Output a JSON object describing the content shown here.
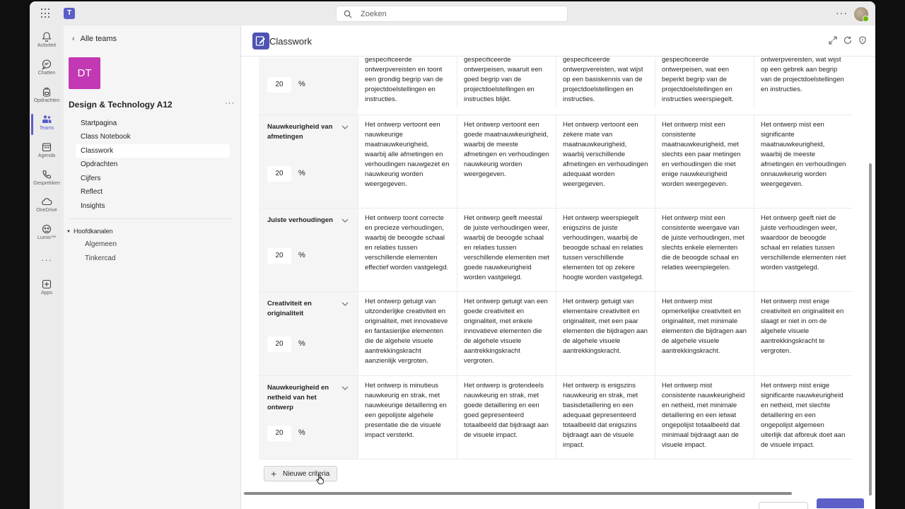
{
  "search": {
    "placeholder": "Zoeken"
  },
  "rail": [
    {
      "label": "Activiteit",
      "icon": "bell-icon"
    },
    {
      "label": "Chatten",
      "icon": "chat-icon"
    },
    {
      "label": "Opdrachten",
      "icon": "backpack-icon"
    },
    {
      "label": "Teams",
      "icon": "teams-icon",
      "active": true
    },
    {
      "label": "Agenda",
      "icon": "calendar-icon"
    },
    {
      "label": "Gesprekken",
      "icon": "phone-icon"
    },
    {
      "label": "OneDrive",
      "icon": "cloud-icon"
    },
    {
      "label": "Lumio™",
      "icon": "lumio-icon"
    },
    {
      "label": "Apps",
      "icon": "apps-icon"
    }
  ],
  "team": {
    "back_label": "Alle teams",
    "initials": "DT",
    "name": "Design & Technology A12",
    "nav": [
      "Startpagina",
      "Class Notebook",
      "Classwork",
      "Opdrachten",
      "Cijfers",
      "Reflect",
      "Insights"
    ],
    "channels_header": "Hoofdkanalen",
    "channels": [
      "Algemeen",
      "Tinkercad"
    ]
  },
  "app": {
    "title": "Classwork"
  },
  "rubric": {
    "rows": [
      {
        "name": "",
        "weight": "20",
        "cells": [
          "gespecificeerde ontwerpvereisten en toont een grondig begrip van de projectdoelstellingen en instructies.",
          "gespecificeerde ontwerpeisen, waaruit een goed begrip van de projectdoelstellingen en instructies blijkt.",
          "gespecificeerde ontwerpvereisten, wat wijst op een basiskennis van de projectdoelstellingen en instructies.",
          "gespecificeerde ontwerpeisen, wat een beperkt begrip van de projectdoelstellingen en instructies weerspiegelt.",
          "ontwerpvereisten, wat wijst op een gebrek aan begrip van de projectdoelstellingen en instructies."
        ]
      },
      {
        "name": "Nauwkeurigheid van afmetingen",
        "weight": "20",
        "cells": [
          "Het ontwerp vertoont een nauwkeurige maatnauwkeurigheid, waarbij alle afmetingen en verhoudingen nauwgezet en nauwkeurig worden weergegeven.",
          "Het ontwerp vertoont een goede maatnauwkeurigheid, waarbij de meeste afmetingen en verhoudingen nauwkeurig worden weergegeven.",
          "Het ontwerp vertoont een zekere mate van maatnauwkeurigheid, waarbij verschillende afmetingen en verhoudingen adequaat worden weergegeven.",
          "Het ontwerp mist een consistente maatnauwkeurigheid, met slechts een paar metingen en verhoudingen die met enige nauwkeurigheid worden weergegeven.",
          "Het ontwerp mist een significante maatnauwkeurigheid, waarbij de meeste afmetingen en verhoudingen onnauwkeurig worden weergegeven."
        ]
      },
      {
        "name": "Juiste verhoudingen",
        "weight": "20",
        "cells": [
          "Het ontwerp toont correcte en precieze verhoudingen, waarbij de beoogde schaal en relaties tussen verschillende elementen effectief worden vastgelegd.",
          "Het ontwerp geeft meestal de juiste verhoudingen weer, waarbij de beoogde schaal en relaties tussen verschillende elementen met goede nauwkeurigheid worden vastgelegd.",
          "Het ontwerp weerspiegelt enigszins de juiste verhoudingen, waarbij de beoogde schaal en relaties tussen verschillende elementen tot op zekere hoogte worden vastgelegd.",
          "Het ontwerp mist een consistente weergave van de juiste verhoudingen, met slechts enkele elementen die de beoogde schaal en relaties weerspiegelen.",
          "Het ontwerp geeft niet de juiste verhoudingen weer, waardoor de beoogde schaal en relaties tussen verschillende elementen niet worden vastgelegd."
        ]
      },
      {
        "name": "Creativiteit en originaliteit",
        "weight": "20",
        "cells": [
          "Het ontwerp getuigt van uitzonderlijke creativiteit en originaliteit, met innovatieve en fantasierijke elementen die de algehele visuele aantrekkingskracht aanzienlijk vergroten.",
          "Het ontwerp getuigt van een goede creativiteit en originaliteit, met enkele innovatieve elementen die de algehele visuele aantrekkingskracht vergroten.",
          "Het ontwerp getuigt van elementaire creativiteit en originaliteit, met een paar elementen die bijdragen aan de algehele visuele aantrekkingskracht.",
          "Het ontwerp mist opmerkelijke creativiteit en originaliteit, met minimale elementen die bijdragen aan de algehele visuele aantrekkingskracht.",
          "Het ontwerp mist enige creativiteit en originaliteit en slaagt er niet in om de algehele visuele aantrekkingskracht te vergroten."
        ]
      },
      {
        "name": "Nauwkeurigheid en netheid van het ontwerp",
        "weight": "20",
        "cells": [
          "Het ontwerp is minutieus nauwkeurig en strak, met nauwkeurige detaillering en een gepolijste algehele presentatie die de visuele impact versterkt.",
          "Het ontwerp is grotendeels nauwkeurig en strak, met goede detaillering en een goed gepresenteerd totaalbeeld dat bijdraagt aan de visuele impact.",
          "Het ontwerp is enigszins nauwkeurig en strak, met basisdetaillering en een adequaat gepresenteerd totaalbeeld dat enigszins bijdraagt aan de visuele impact.",
          "Het ontwerp mist consistente nauwkeurigheid en netheid, met minimale detaillering en een ietwat ongepolijst totaalbeeld dat minimaal bijdraagt aan de visuele impact.",
          "Het ontwerp mist enige significante nauwkeurigheid en netheid, met slechte detaillering en een ongepolijst algemeen uiterlijk dat afbreuk doet aan de visuele impact."
        ]
      }
    ],
    "percent_symbol": "%",
    "add_button": "Nieuwe criteria"
  }
}
